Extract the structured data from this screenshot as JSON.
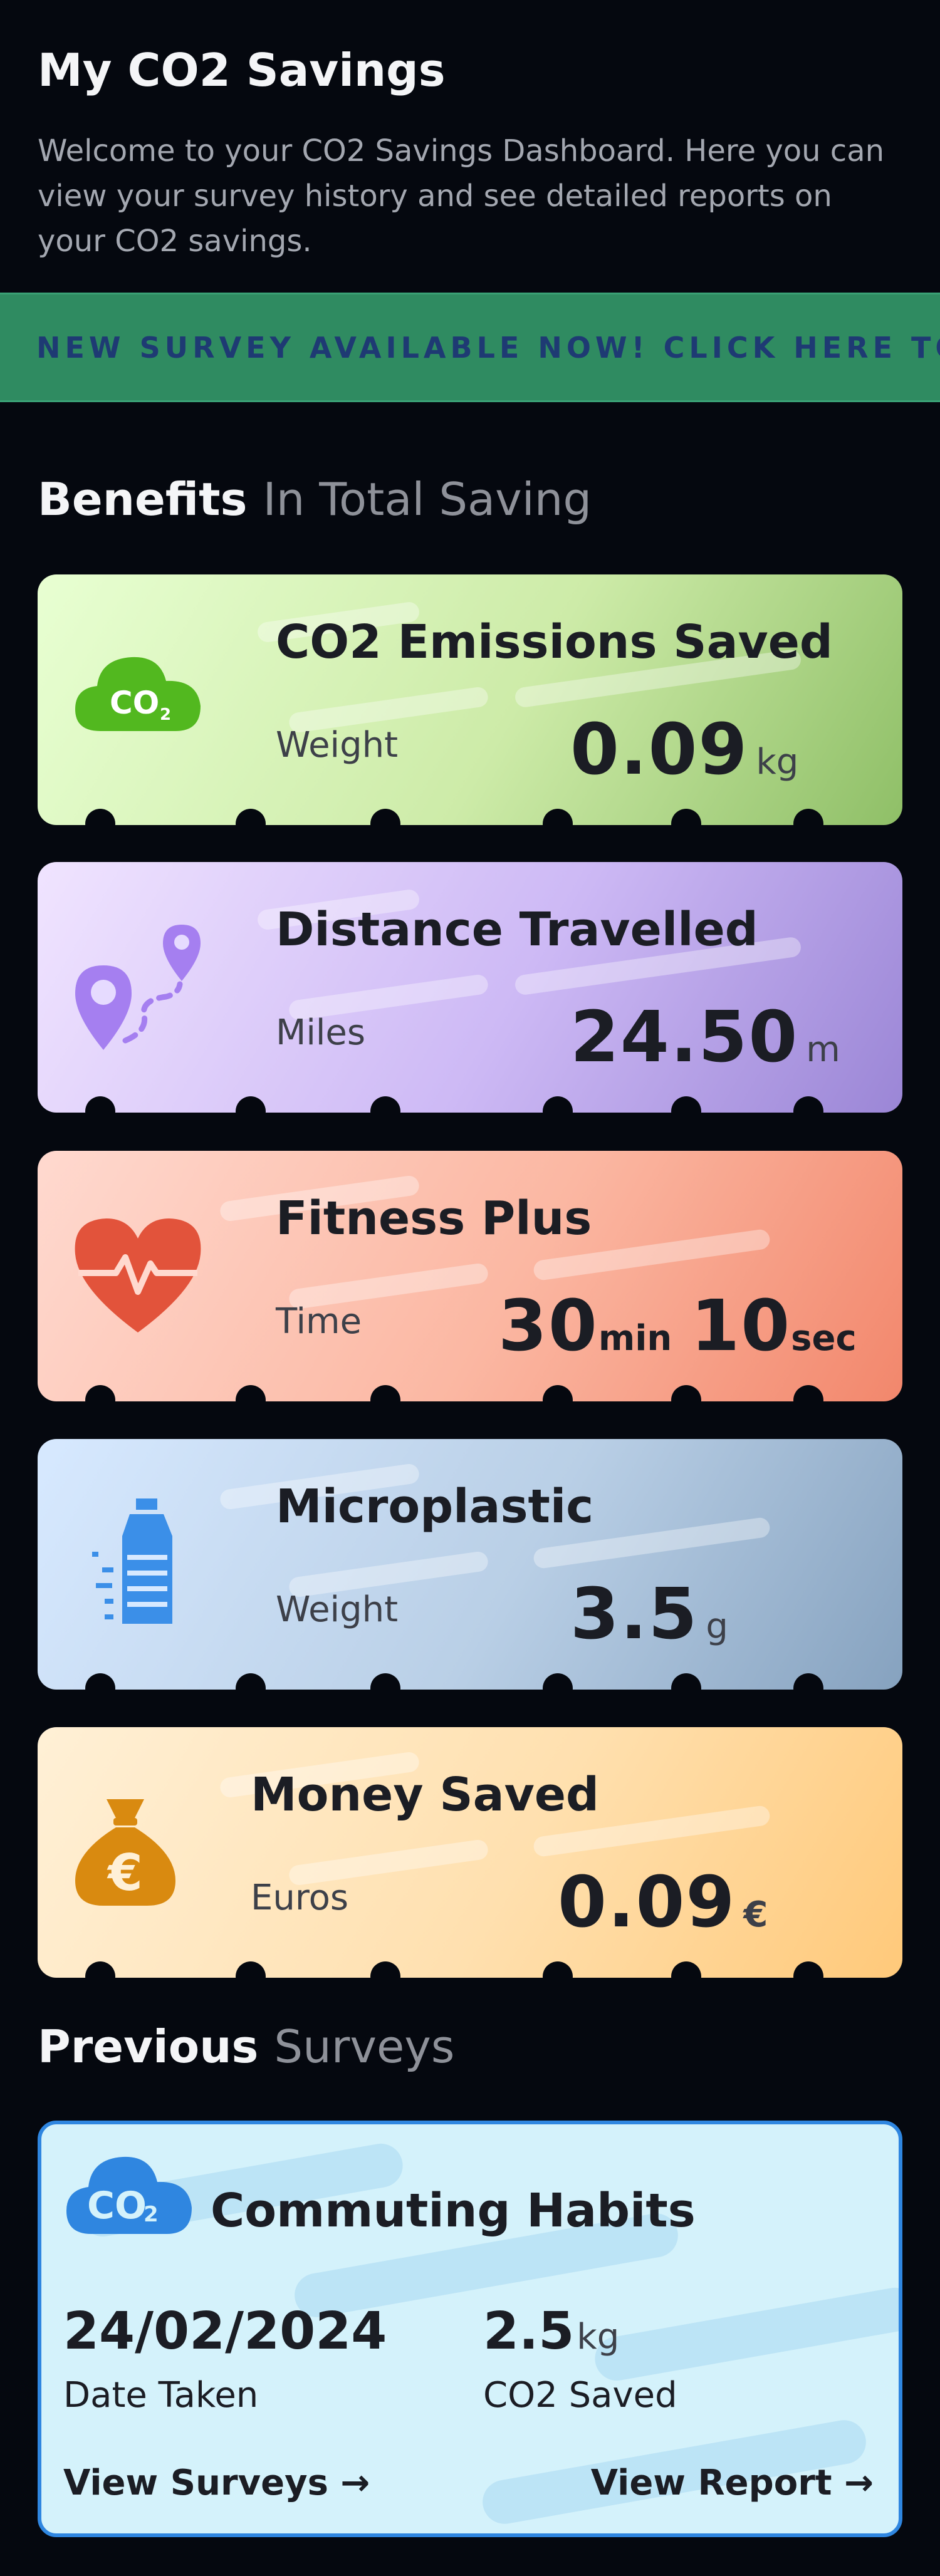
{
  "page": {
    "title": "My CO2 Savings",
    "intro": "Welcome to your CO2 Savings Dashboard. Here you can view your survey history and see detailed reports on your CO2 savings."
  },
  "banner": {
    "text": "NEW SURVEY AVAILABLE NOW! CLICK HERE TO TAKE IT"
  },
  "benefits_heading": {
    "strong": "Benefits",
    "muted": "In Total Saving"
  },
  "cards": {
    "co2": {
      "title": "CO2 Emissions Saved",
      "label": "Weight",
      "value": "0.09",
      "unit": "kg",
      "icon": "co2-cloud-icon",
      "icon_text": "CO",
      "icon_sub": "2"
    },
    "distance": {
      "title": "Distance Travelled",
      "label": "Miles",
      "value": "24.50",
      "unit": "m",
      "icon": "route-pin-icon"
    },
    "fitness": {
      "title": "Fitness Plus",
      "label": "Time",
      "minutes": "30",
      "min_unit": "min",
      "seconds": "10",
      "sec_unit": "sec",
      "icon": "heart-pulse-icon"
    },
    "micro": {
      "title": "Microplastic",
      "label": "Weight",
      "value": "3.5",
      "unit": "g",
      "icon": "water-bottle-icon"
    },
    "money": {
      "title": "Money Saved",
      "label": "Euros",
      "value": "0.09",
      "unit": "€",
      "icon": "money-bag-icon",
      "icon_text": "€"
    }
  },
  "previous_heading": {
    "strong": "Previous",
    "muted": "Surveys"
  },
  "survey": {
    "icon_text": "CO",
    "icon_sub": "2",
    "title": "Commuting Habits",
    "date": "24/02/2024",
    "date_label": "Date Taken",
    "co2_value": "2.5",
    "co2_unit": "kg",
    "co2_label": "CO2 Saved",
    "view_surveys": "View Surveys →",
    "view_report": "View Report →"
  },
  "colors": {
    "background": "#05080f",
    "banner": "#2f8b61",
    "banner_text": "#1e3a73",
    "co2_icon": "#52b81f",
    "distance_icon": "#a57ff0",
    "fitness_icon": "#e2533b",
    "micro_icon": "#3b8fe8",
    "money_icon": "#d98a10",
    "survey_border": "#2f86e0"
  }
}
